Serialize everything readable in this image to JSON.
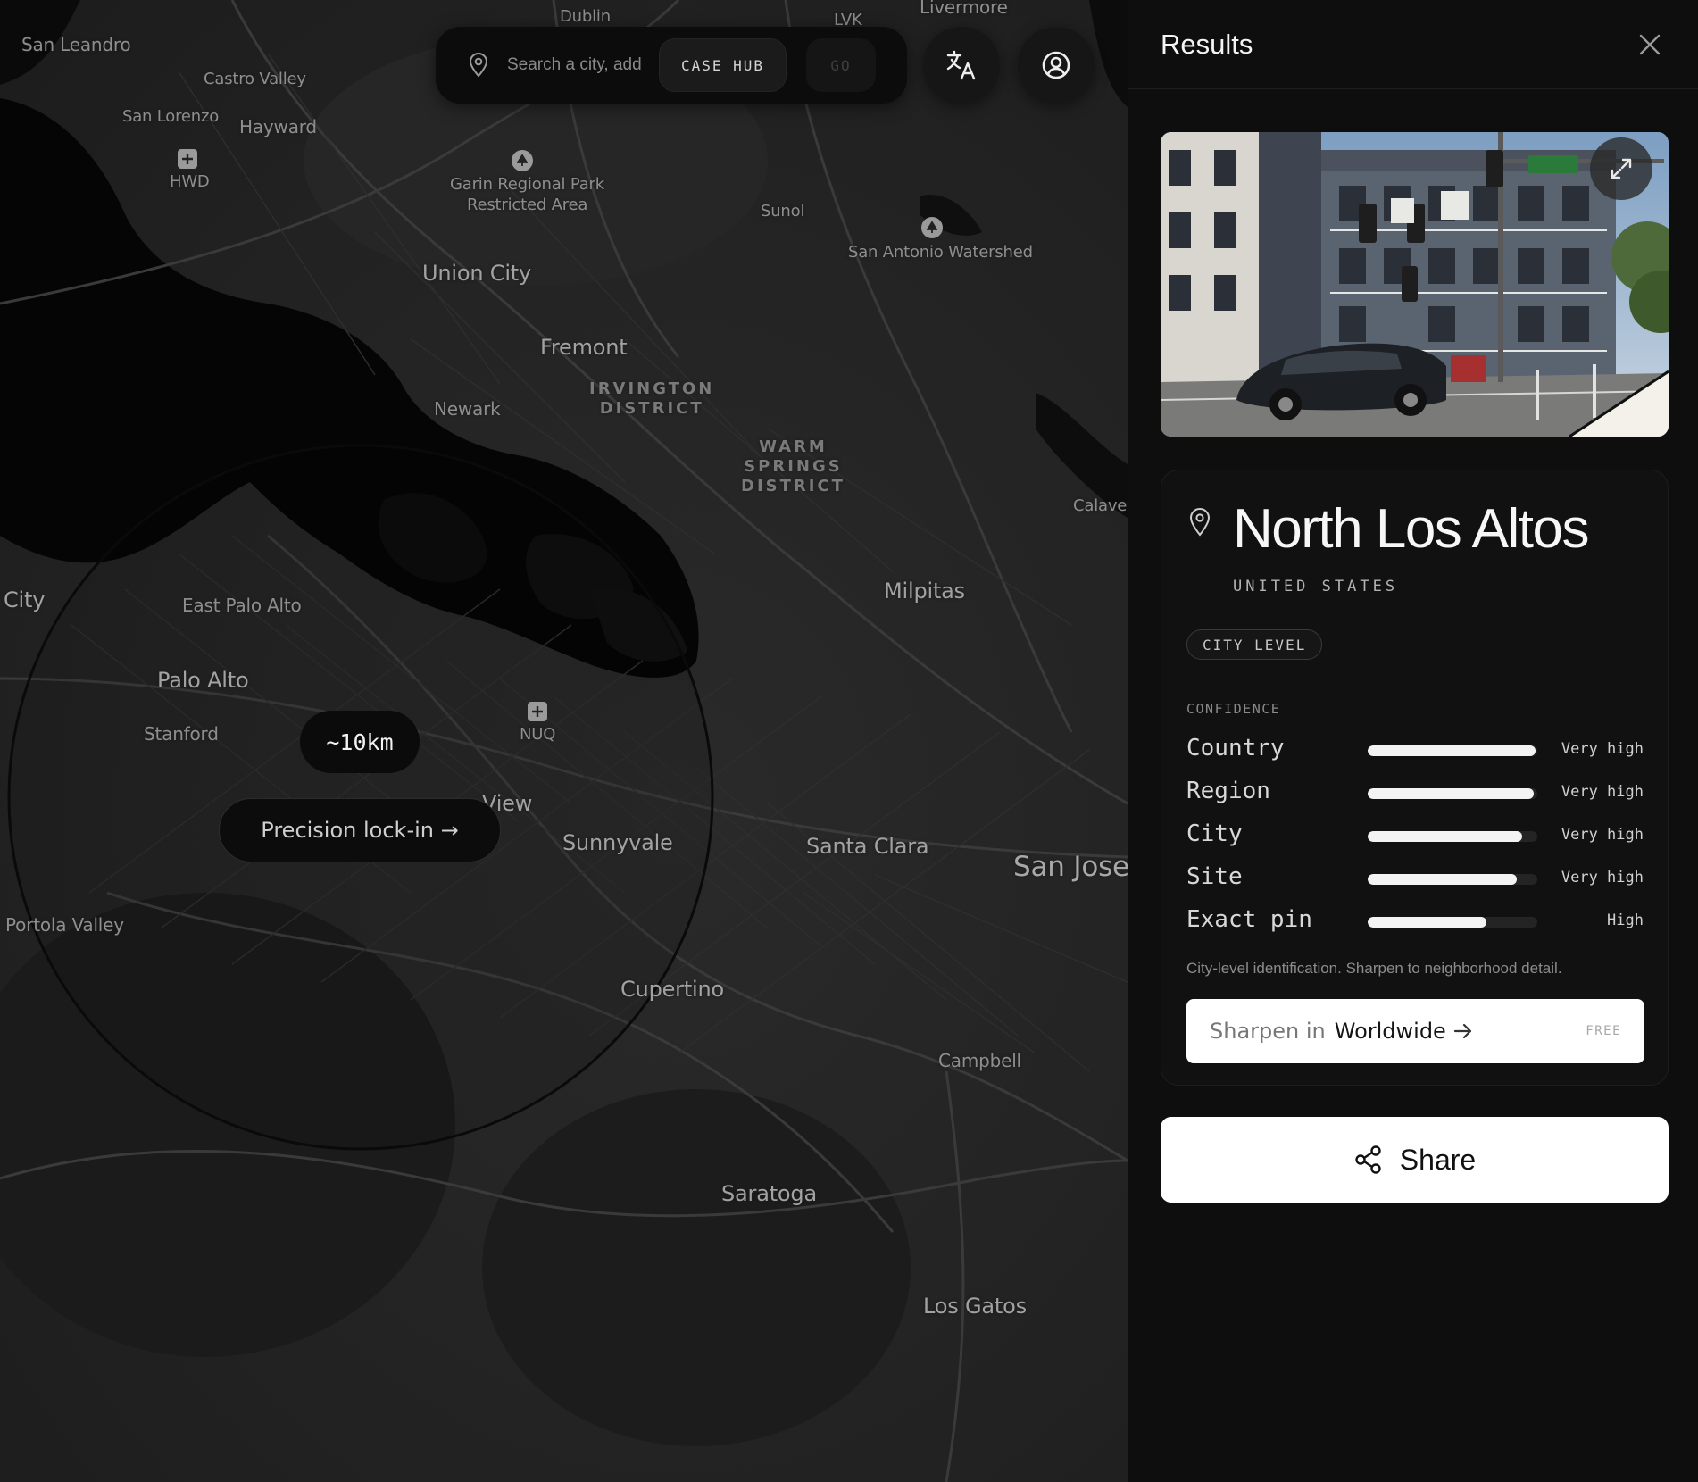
{
  "map": {
    "places": [
      {
        "label": "Dublin",
        "cls": "sm"
      },
      {
        "label": "LVK",
        "cls": "sm"
      },
      {
        "label": "Livermore",
        "cls": ""
      },
      {
        "label": "San Leandro",
        "cls": ""
      },
      {
        "label": "Castro Valley",
        "cls": "sm"
      },
      {
        "label": "San Lorenzo",
        "cls": "sm"
      },
      {
        "label": "Hayward",
        "cls": ""
      },
      {
        "label": "HWD",
        "cls": "sm"
      },
      {
        "label": "Garin Regional Park",
        "cls": "sm"
      },
      {
        "label": "Restricted Area",
        "cls": "sm"
      },
      {
        "label": "Sunol",
        "cls": "sm"
      },
      {
        "label": "San Antonio Watershed",
        "cls": "sm"
      },
      {
        "label": "Union City",
        "cls": "lg"
      },
      {
        "label": "Fremont",
        "cls": "lg"
      },
      {
        "label": "Newark",
        "cls": ""
      },
      {
        "label": "Calaver",
        "cls": "sm"
      },
      {
        "label": "City",
        "cls": "lg"
      },
      {
        "label": "East Palo Alto",
        "cls": ""
      },
      {
        "label": "Milpitas",
        "cls": "lg"
      },
      {
        "label": "Palo Alto",
        "cls": "lg"
      },
      {
        "label": "Stanford",
        "cls": ""
      },
      {
        "label": "NUQ",
        "cls": "sm"
      },
      {
        "label": "View",
        "cls": "lg"
      },
      {
        "label": "Sunnyvale",
        "cls": "lg"
      },
      {
        "label": "Santa Clara",
        "cls": "lg"
      },
      {
        "label": "San Jose",
        "cls": "xl"
      },
      {
        "label": "Portola Valley",
        "cls": ""
      },
      {
        "label": "Cupertino",
        "cls": "lg"
      },
      {
        "label": "Campbell",
        "cls": ""
      },
      {
        "label": "Saratoga",
        "cls": "lg"
      },
      {
        "label": "Los Gatos",
        "cls": "lg"
      }
    ],
    "districts": {
      "irvington": "IRVINGTON\nDISTRICT",
      "warm_springs": "WARM\nSPRINGS\nDISTRICT"
    },
    "radius_label": "~10km",
    "lockin_label": "Precision lock-in →"
  },
  "search": {
    "placeholder": "Search a city, address…",
    "case_hub": "CASE HUB",
    "go": "GO"
  },
  "icons": {
    "search_pin": "map-pin-icon",
    "translate": "translate-icon",
    "account": "user-circle-icon",
    "close": "close-icon",
    "expand": "expand-icon",
    "share": "share-icon",
    "arrow": "arrow-right-icon"
  },
  "results": {
    "title": "Results",
    "location": {
      "name": "North Los Altos",
      "country": "UNITED STATES",
      "level": "CITY LEVEL"
    },
    "confidence": {
      "title": "CONFIDENCE",
      "rows": [
        {
          "label": "Country",
          "value": "Very high",
          "fill": 0.99
        },
        {
          "label": "Region",
          "value": "Very high",
          "fill": 0.98
        },
        {
          "label": "City",
          "value": "Very high",
          "fill": 0.91
        },
        {
          "label": "Site",
          "value": "Very high",
          "fill": 0.88
        },
        {
          "label": "Exact pin",
          "value": "High",
          "fill": 0.7
        }
      ]
    },
    "note": "City-level identification. Sharpen to neighborhood detail.",
    "sharpen": {
      "prefix": "Sharpen in",
      "target": "Worldwide",
      "tag": "FREE"
    },
    "share_label": "Share"
  },
  "colors": {
    "panel_bg": "#0e0e0e",
    "map_bg": "#232323",
    "accent": "#ffffff"
  }
}
